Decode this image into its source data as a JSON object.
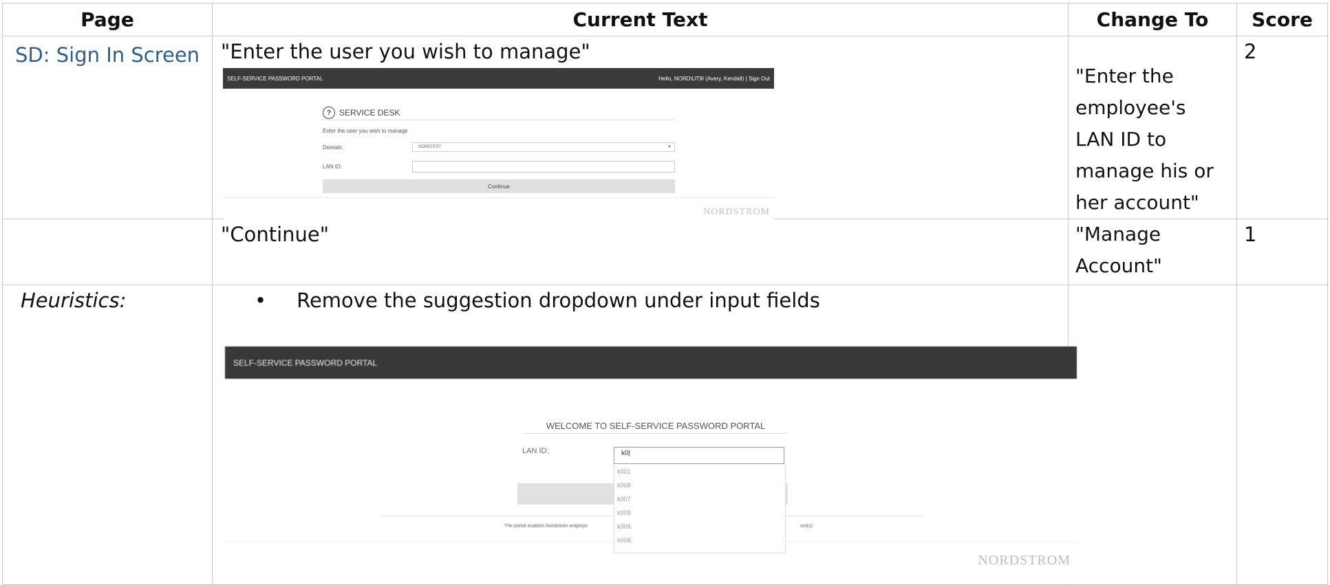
{
  "headers": {
    "page": "Page",
    "current": "Current Text",
    "change": "Change To",
    "score": "Score"
  },
  "rows": [
    {
      "page": "SD: Sign In Screen",
      "current": "\"Enter the user you wish to manage\"",
      "change": "\"Enter the employee's LAN ID to manage his or her account\"",
      "score": "2"
    },
    {
      "page": "",
      "current": "\"Continue\"",
      "change": "\"Manage Account\"",
      "score": "1"
    }
  ],
  "heuristics": {
    "label": "Heuristics:",
    "bullet": "•",
    "text": "Remove the suggestion dropdown under input fields"
  },
  "shot1": {
    "bar_title": "SELF-SERVICE PASSWORD PORTAL",
    "bar_user": "Hello, NORD\\UT9I (Avery, Kendall) | Sign Out",
    "help_icon": "?",
    "section": "SERVICE DESK",
    "prompt": "Enter the user you wish to manage",
    "domain_label": "Domain:",
    "domain_value": "NORDTEST",
    "lan_label": "LAN ID:",
    "continue": "Continue",
    "logo": "NORDSTROM"
  },
  "shot2": {
    "bar_title": "SELF-SERVICE PASSWORD PORTAL",
    "welcome": "WELCOME TO SELF-SERVICE PASSWORD PORTAL",
    "lan_label": "LAN ID:",
    "lan_value": "k0|",
    "suggestions": [
      "k001",
      "k008",
      "k007",
      "k009",
      "k009.",
      "k008."
    ],
    "note_left": "The portal enables Nordstrom employe",
    "note_right": "unt(s)",
    "logo": "NORDSTROM"
  }
}
